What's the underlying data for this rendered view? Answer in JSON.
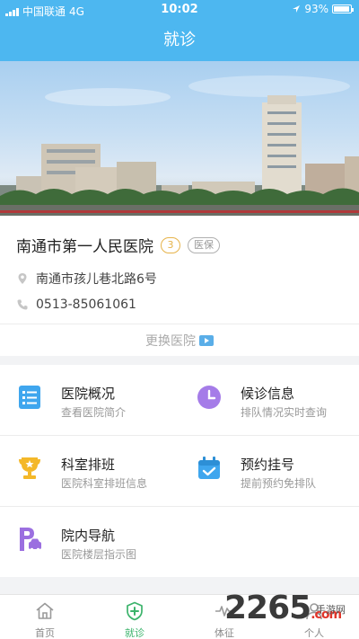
{
  "status_bar": {
    "carrier": "中国联通",
    "network": "4G",
    "time": "10:02",
    "battery": "93%",
    "battery_level": 0.93
  },
  "nav": {
    "title": "就诊"
  },
  "hospital": {
    "name": "南通市第一人民医院",
    "level_badge": "3",
    "insurance_badge": "医保",
    "address": "南通市孩儿巷北路6号",
    "phone": "0513-85061061",
    "switch_label": "更换医院"
  },
  "services": [
    {
      "title": "医院概况",
      "subtitle": "查看医院简介",
      "icon": "document-list-icon"
    },
    {
      "title": "候诊信息",
      "subtitle": "排队情况实时查询",
      "icon": "clock-icon"
    },
    {
      "title": "科室排班",
      "subtitle": "医院科室排班信息",
      "icon": "trophy-icon"
    },
    {
      "title": "预约挂号",
      "subtitle": "提前预约免排队",
      "icon": "calendar-check-icon"
    },
    {
      "title": "院内导航",
      "subtitle": "医院楼层指示图",
      "icon": "parking-navigation-icon"
    }
  ],
  "tabs": [
    {
      "label": "首页",
      "icon": "home-icon",
      "active": false
    },
    {
      "label": "就诊",
      "icon": "medical-cross-icon",
      "active": true
    },
    {
      "label": "体征",
      "icon": "vital-signs-icon",
      "active": false
    },
    {
      "label": "个人",
      "icon": "person-icon",
      "active": false
    }
  ],
  "watermark": {
    "brand_main": "2265",
    "brand_suffix": ".com",
    "brand_tag": "手游网"
  },
  "colors": {
    "primary": "#4db7f0",
    "active_tab": "#3bb36b",
    "badge_gold": "#e6b34a"
  }
}
